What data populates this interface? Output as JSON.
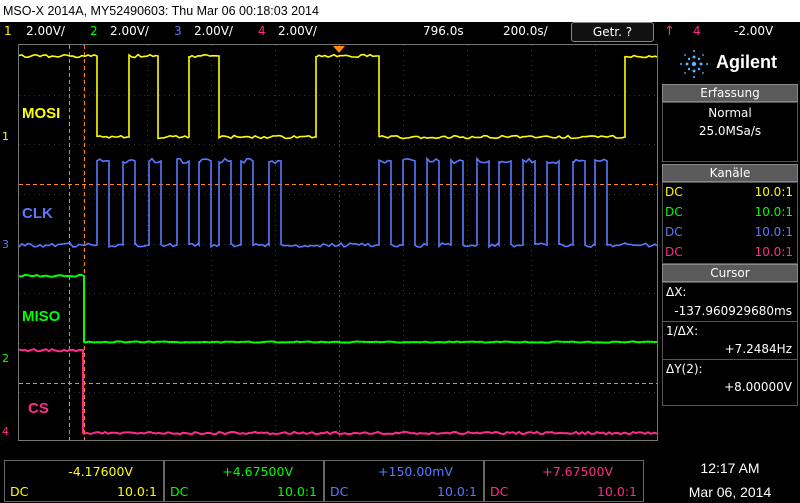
{
  "window": {
    "title": "MSO-X 2014A, MY52490603: Thu Mar 06 00:18:03 2014"
  },
  "channel_bar": {
    "ch1": {
      "num": "1",
      "scale": "2.00V/"
    },
    "ch2": {
      "num": "2",
      "scale": "2.00V/"
    },
    "ch3": {
      "num": "3",
      "scale": "2.00V/"
    },
    "ch4": {
      "num": "4",
      "scale": "2.00V/"
    },
    "delay": "796.0s",
    "timebase": "200.0s/",
    "trigger_mode": "Getr. ?",
    "trigger_source": "4",
    "trigger_level": "-2.00V"
  },
  "labels": {
    "mosi": "MOSI",
    "clk": "CLK",
    "miso": "MISO",
    "cs": "CS"
  },
  "ground_markers": {
    "ch1": "1",
    "ch3": "3",
    "ch2": "2",
    "ch4": "4"
  },
  "panel": {
    "brand": "Agilent",
    "acquisition": {
      "header": "Erfassung",
      "mode": "Normal",
      "rate": "25.0MSa/s"
    },
    "channels": {
      "header": "Kanäle",
      "rows": [
        {
          "coupling": "DC",
          "ratio": "10.0:1",
          "color": "#ffff00"
        },
        {
          "coupling": "DC",
          "ratio": "10.0:1",
          "color": "#00ff00"
        },
        {
          "coupling": "DC",
          "ratio": "10.0:1",
          "color": "#5a78ff"
        },
        {
          "coupling": "DC",
          "ratio": "10.0:1",
          "color": "#ff2b8a"
        }
      ]
    },
    "cursor": {
      "header": "Cursor",
      "dx_label": "ΔX:",
      "dx_value": "-137.960929680ms",
      "inv_dx_label": "1/ΔX:",
      "inv_dx_value": "+7.2484Hz",
      "dy_label": "ΔY(2):",
      "dy_value": "+8.00000V"
    }
  },
  "bottom": {
    "boxes": [
      {
        "value": "-4.17600V",
        "coupling": "DC",
        "ratio": "10.0:1",
        "color": "#ffff00"
      },
      {
        "value": "+4.67500V",
        "coupling": "DC",
        "ratio": "10.0:1",
        "color": "#00ff00"
      },
      {
        "value": "+150.00mV",
        "coupling": "DC",
        "ratio": "10.0:1",
        "color": "#5a78ff"
      },
      {
        "value": "+7.67500V",
        "coupling": "DC",
        "ratio": "10.0:1",
        "color": "#ff2b8a"
      }
    ],
    "time": "12:17 AM",
    "date": "Mar 06, 2014"
  },
  "colors": {
    "ch1": "#ffff00",
    "ch2": "#00ff00",
    "ch3": "#5a78ff",
    "ch4": "#ff2b8a",
    "cursor": "#ff8800"
  }
}
